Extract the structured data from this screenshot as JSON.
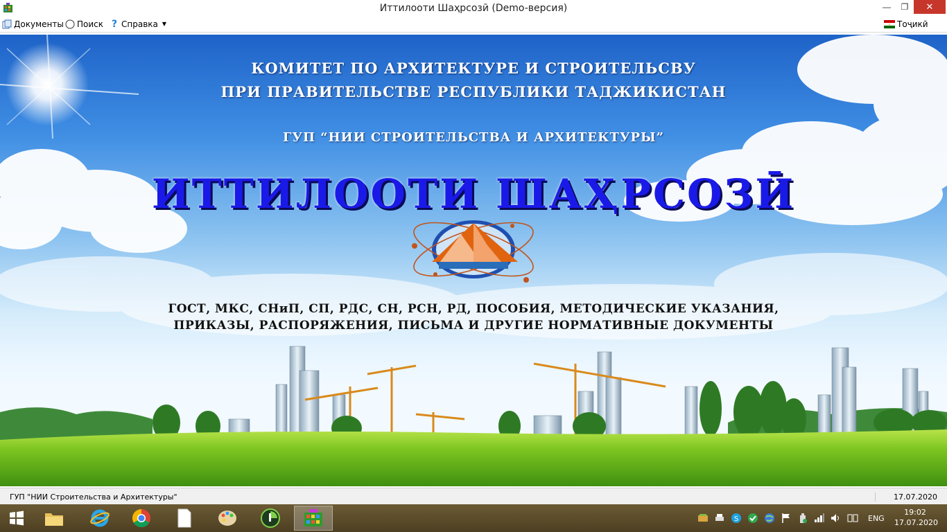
{
  "window": {
    "title": "Иттилооти Шаҳрсозӣ (Demo-версия)"
  },
  "menu": {
    "documents": "Документы",
    "search": "Поиск",
    "help": "Справка",
    "language": "Тоҷикӣ"
  },
  "splash": {
    "heading_line1": "КОМИТЕТ ПО АРХИТЕКТУРЕ И СТРОИТЕЛЬСВУ",
    "heading_line2": "ПРИ ПРАВИТЕЛЬСТВЕ РЕСПУБЛИКИ ТАДЖИКИСТАН",
    "organization": "ГУП “НИИ СТРОИТЕЛЬСТВА И АРХИТЕКТУРЫ”",
    "brand": "ИТТИЛООТИ ШАҲРСОЗӢ",
    "docs_line1": "ГОСТ, МКС, СНиП, СП,  РДС, СН, РСН, РД,  ПОСОБИЯ, МЕТОДИЧЕСКИЕ УКАЗАНИЯ,",
    "docs_line2": "ПРИКАЗЫ, РАСПОРЯЖЕНИЯ, ПИСЬМА И ДРУГИЕ НОРМАТИВНЫЕ ДОКУМЕНТЫ"
  },
  "statusbar": {
    "organization": "ГУП \"НИИ Строительства и Архитектуры\"",
    "date": "17.07.2020"
  },
  "taskbar": {
    "language": "ENG",
    "time": "19:02",
    "date": "17.07.2020",
    "pinned": [
      "start-icon",
      "file-explorer-icon",
      "internet-explorer-icon",
      "chrome-icon",
      "document-icon",
      "paint-icon",
      "media-icon",
      "app-icon"
    ]
  },
  "colors": {
    "brand": "#1a1ae8",
    "close_button": "#c7362b",
    "taskbar": "#5a4a28"
  }
}
